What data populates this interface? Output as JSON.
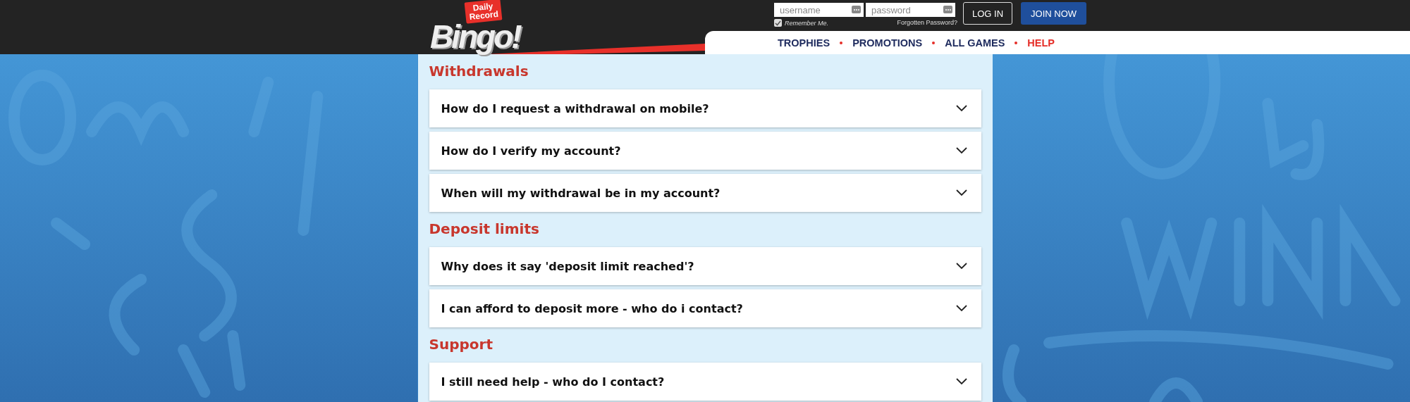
{
  "header": {
    "logo": {
      "badge": [
        "Daily",
        "Record"
      ],
      "wordmark": "Bingo!"
    },
    "login": {
      "username": {
        "placeholder": "username"
      },
      "password": {
        "placeholder": "password"
      },
      "remember": {
        "label": "Remember Me.",
        "checked": true
      },
      "forgot": "Forgotten Password?",
      "buttons": [
        {
          "label": "LOG IN",
          "kind": "outline"
        },
        {
          "label": "JOIN NOW",
          "kind": "primary"
        }
      ]
    },
    "nav": [
      {
        "label": "TROPHIES",
        "selected": false
      },
      {
        "label": "PROMOTIONS",
        "selected": false
      },
      {
        "label": "ALL GAMES",
        "selected": false
      },
      {
        "label": "HELP",
        "selected": true
      }
    ]
  },
  "sections": [
    {
      "title": "Withdrawals",
      "questions": [
        {
          "text": "How do I request a withdrawal on mobile?",
          "expanded": false
        },
        {
          "text": "How do I verify my account?",
          "expanded": false
        },
        {
          "text": "When will my withdrawal be in my account?",
          "expanded": false
        }
      ]
    },
    {
      "title": "Deposit limits",
      "questions": [
        {
          "text": "Why does it say 'deposit limit reached'?",
          "expanded": false
        },
        {
          "text": "I can afford to deposit more - who do i contact?",
          "expanded": false
        }
      ]
    },
    {
      "title": "Support",
      "questions": [
        {
          "text": "I still need help - who do I contact?",
          "expanded": false
        }
      ]
    }
  ]
}
